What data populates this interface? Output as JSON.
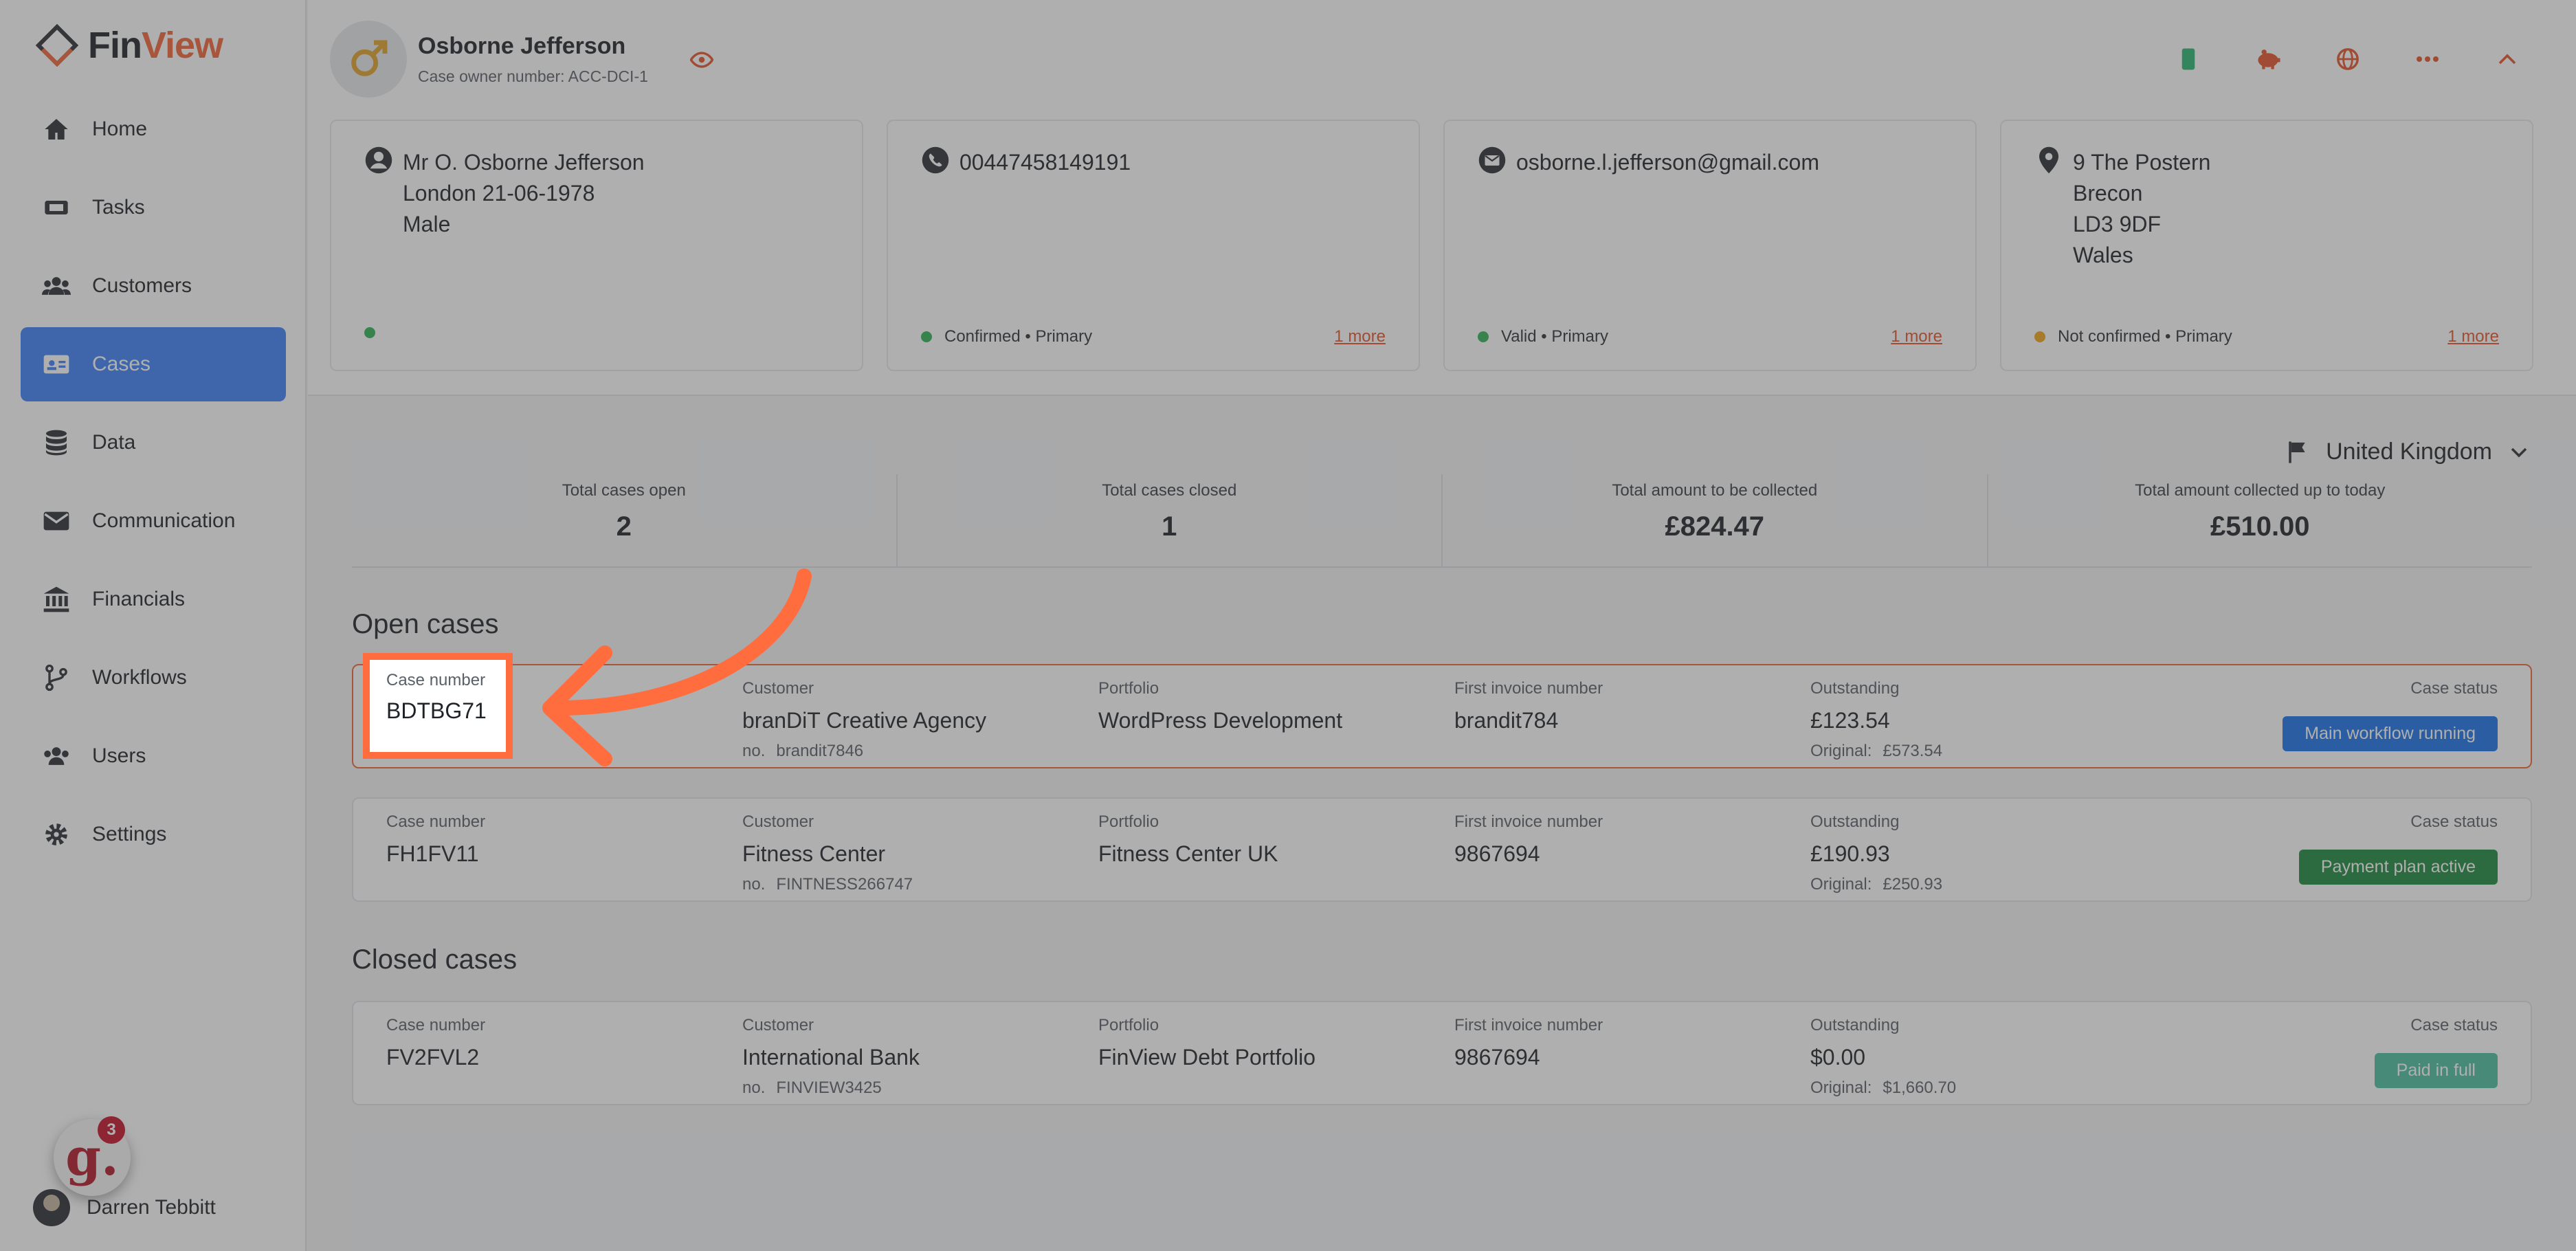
{
  "app": {
    "logo_prefix": "Fin",
    "logo_suffix": "View"
  },
  "sidebar": {
    "items": [
      {
        "label": "Home",
        "icon": "home-icon",
        "active": false
      },
      {
        "label": "Tasks",
        "icon": "ticket-icon",
        "active": false
      },
      {
        "label": "Customers",
        "icon": "people-icon",
        "active": false
      },
      {
        "label": "Cases",
        "icon": "id-card-icon",
        "active": true
      },
      {
        "label": "Data",
        "icon": "database-icon",
        "active": false
      },
      {
        "label": "Communication",
        "icon": "envelope-icon",
        "active": false
      },
      {
        "label": "Financials",
        "icon": "bank-icon",
        "active": false
      },
      {
        "label": "Workflows",
        "icon": "branch-icon",
        "active": false
      },
      {
        "label": "Users",
        "icon": "users-icon",
        "active": false
      },
      {
        "label": "Settings",
        "icon": "gear-icon",
        "active": false
      }
    ],
    "user_name": "Darren Tebbitt",
    "notification_count": "3",
    "widget_letter": "g."
  },
  "profile": {
    "name": "Osborne Jefferson",
    "case_owner": "Case owner number: ACC-DCI-1"
  },
  "info_cards": {
    "personal": {
      "line1": "Mr O. Osborne Jefferson",
      "line2": "London 21-06-1978",
      "line3": "Male"
    },
    "phone": {
      "value": "00447458149191",
      "status": "Confirmed • Primary",
      "more": "1 more"
    },
    "email": {
      "value": "osborne.l.jefferson@gmail.com",
      "status": "Valid • Primary",
      "more": "1 more"
    },
    "address": {
      "line1": "9 The Postern",
      "line2": "Brecon",
      "line3": "LD3 9DF",
      "line4": "Wales",
      "status": "Not confirmed • Primary",
      "more": "1 more"
    }
  },
  "country": "United Kingdom",
  "stats": [
    {
      "label": "Total cases open",
      "value": "2"
    },
    {
      "label": "Total cases closed",
      "value": "1"
    },
    {
      "label": "Total amount to be collected",
      "value": "£824.47"
    },
    {
      "label": "Total amount collected up to today",
      "value": "£510.00"
    }
  ],
  "labels": {
    "case_number": "Case number",
    "customer": "Customer",
    "portfolio": "Portfolio",
    "first_invoice": "First invoice number",
    "outstanding": "Outstanding",
    "case_status": "Case status",
    "no": "no.",
    "original": "Original:"
  },
  "open_title": "Open cases",
  "closed_title": "Closed cases",
  "open_cases": [
    {
      "case_number": "BDTBG71",
      "customer": "branDiT Creative Agency",
      "customer_no": "brandit7846",
      "portfolio": "WordPress Development",
      "invoice": "brandit784",
      "outstanding": "£123.54",
      "original": "£573.54",
      "status": "Main workflow running",
      "status_color": "#1a73e8"
    },
    {
      "case_number": "FH1FV11",
      "customer": "Fitness Center",
      "customer_no": "FINTNESS266747",
      "portfolio": "Fitness Center UK",
      "invoice": "9867694",
      "outstanding": "£190.93",
      "original": "£250.93",
      "status": "Payment plan active",
      "status_color": "#1c8a3e"
    }
  ],
  "closed_cases": [
    {
      "case_number": "FV2FVL2",
      "customer": "International Bank",
      "customer_no": "FINVIEW3425",
      "portfolio": "FinView Debt Portfolio",
      "invoice": "9867694",
      "outstanding": "$0.00",
      "original": "$1,660.70",
      "status": "Paid in full",
      "status_color": "#4bbf9f"
    }
  ],
  "colors": {
    "accent": "#f2673a",
    "active_nav": "#3f82f7",
    "highlight": "#ff6d3f"
  }
}
